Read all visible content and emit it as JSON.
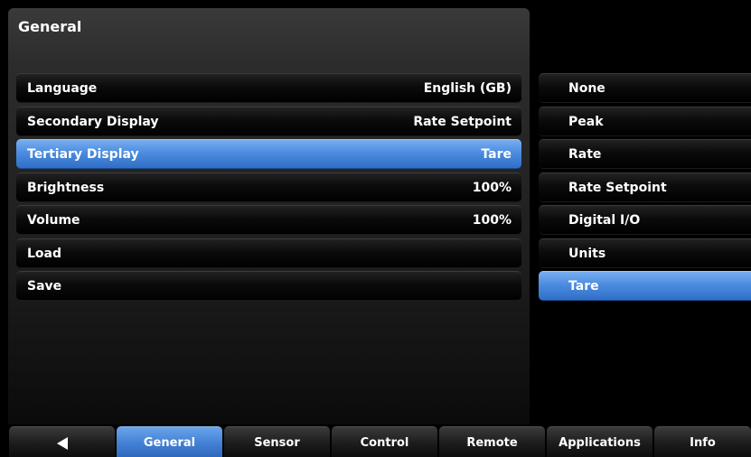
{
  "panel": {
    "title": "General"
  },
  "settings": [
    {
      "label": "Language",
      "value": "English (GB)"
    },
    {
      "label": "Secondary Display",
      "value": "Rate Setpoint"
    },
    {
      "label": "Tertiary Display",
      "value": "Tare",
      "selected": true
    },
    {
      "label": "Brightness",
      "value": "100%"
    },
    {
      "label": "Volume",
      "value": "100%"
    },
    {
      "label": "Load",
      "value": ""
    },
    {
      "label": "Save",
      "value": ""
    }
  ],
  "options": [
    {
      "label": "None"
    },
    {
      "label": "Peak"
    },
    {
      "label": "Rate"
    },
    {
      "label": "Rate Setpoint"
    },
    {
      "label": "Digital I/O"
    },
    {
      "label": "Units"
    },
    {
      "label": "Tare",
      "selected": true
    }
  ],
  "tabs": [
    {
      "label": "",
      "icon": "back-arrow-icon"
    },
    {
      "label": "General",
      "active": true
    },
    {
      "label": "Sensor"
    },
    {
      "label": "Control"
    },
    {
      "label": "Remote"
    },
    {
      "label": "Applications"
    },
    {
      "label": "Info"
    }
  ],
  "colors": {
    "selected_blue": "#4c8ce0",
    "background": "#000000"
  }
}
